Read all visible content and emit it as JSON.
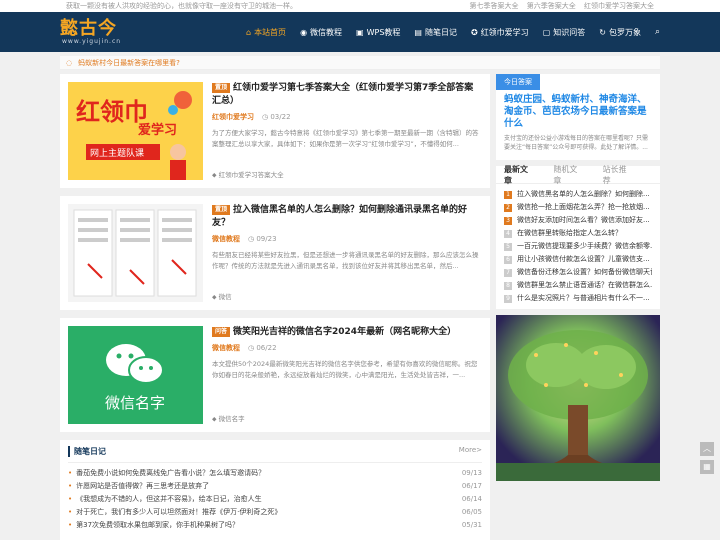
{
  "topbar": {
    "slogan": "获取一颗没有被人洪攻的经验的心，也就像守取一座没有守卫的城池一样。",
    "links": [
      "第七季答案大全",
      "第六季答案大全",
      "红领巾爱学习答案大全"
    ]
  },
  "header": {
    "logo_text": "懿古今",
    "logo_sub": "www.yigujin.cn",
    "nav": [
      {
        "label": "本站首页",
        "icon": "home-icon",
        "glyph": "⌂",
        "active": true
      },
      {
        "label": "微信教程",
        "icon": "wechat-icon",
        "glyph": "◉",
        "active": false
      },
      {
        "label": "WPS教程",
        "icon": "wps-icon",
        "glyph": "▣",
        "active": false
      },
      {
        "label": "随笔日记",
        "icon": "book-icon",
        "glyph": "▤",
        "active": false
      },
      {
        "label": "红领巾爱学习",
        "icon": "flag-icon",
        "glyph": "✪",
        "active": false
      },
      {
        "label": "知识问答",
        "icon": "qa-icon",
        "glyph": "▢",
        "active": false
      },
      {
        "label": "包罗万象",
        "icon": "refresh-icon",
        "glyph": "↻",
        "active": false
      }
    ],
    "search_glyph": "⌕"
  },
  "notice": {
    "text": "蚂蚁新村今日最新答案在哪里看?"
  },
  "posts": [
    {
      "category": "置顶",
      "category_color": "#e07a1f",
      "title": "红领巾爱学习第七季答案大全（红领巾爱学习第7季全部答案汇总）",
      "cat_name": "红领巾爱学习",
      "date": "03/22",
      "desc": "为了方便大家学习，懿古今特意将《红领巾爱学习》第七季第一期至最新一期（含特辑）的答案整理汇总以享大家，具体如下：如果你是第一次学习“红领巾爱学习”，不懂得如何...",
      "tag": "红领巾爱学习答案大全"
    },
    {
      "category": "置顶",
      "category_color": "#e07a1f",
      "title": "拉入微信黑名单的人怎么删除？如何删除通讯录黑名单的好友？",
      "cat_name": "微信教程",
      "date": "09/23",
      "desc": "有些朋友已经将某些好友拉黑，但是还想进一步将通讯录黑名单的好友删除，那么应该怎么操作呢？传统的方法就是先进入通讯录黑名单，找到该位好友并将其移出黑名单，然后...",
      "tag": "微信"
    },
    {
      "category": "问答",
      "category_color": "#e07a1f",
      "title": "微笑阳光吉祥的微信名字2024年最新（网名昵称大全）",
      "cat_name": "微信教程",
      "date": "06/22",
      "desc": "本文提供50个2024最新微笑阳光吉祥的微信名字供您参考，希望有你喜欢的微信昵称。祝您你如春日的花朵般娇艳，永远绽放着灿烂的微笑，心中满是阳光，生活处处皆吉祥，一...",
      "tag": "微信名字"
    }
  ],
  "diary": {
    "title": "随笔日记",
    "more": "More>",
    "items": [
      {
        "text": "番茄免费小说如何免费离线免广告看小说？怎么填写邀请码？",
        "date": "09/13"
      },
      {
        "text": "许愿网站是否值得做？再三思考还是放弃了",
        "date": "06/17"
      },
      {
        "text": "《我想成为不错的人，但这并不容易》，绘本日记，治愈人生",
        "date": "06/14"
      },
      {
        "text": "对于死亡，我们有多少人可以坦然面对！推荐《伊万·伊利奇之死》",
        "date": "06/05"
      },
      {
        "text": "第37次免费领取水果包邮到家，你手机种果树了吗？",
        "date": "05/31"
      }
    ]
  },
  "sidebar": {
    "today_label": "今日答案",
    "today_title": "蚂蚁庄园、蚂蚁新村、神奇海洋、淘金币、芭芭农场今日最新答案是什么",
    "today_desc": "支付宝的还份公益小游戏每日的答案在哪里看呢？只需要关注“每日答案”公众号即可获得。此处了解详情。...",
    "tabs": [
      "最新文章",
      "随机文章",
      "站长推荐"
    ],
    "ranks": [
      "拉入微信黑名单的人怎么删除？如何删除...",
      "微信抢一抢上面烟花怎么弄？抢一抢放烟...",
      "微信好友添加时间怎么看？微信添加好友...",
      "在微信群里转账给指定人怎么转？",
      "一百元微信提现要多少手续费？微信余额零...",
      "用让小孩微信付款怎么设置？儿童微信支...",
      "微信备份迁移怎么设置？如何备份微信聊天记...",
      "微信群里怎么禁止语音通话？在微信群怎么...",
      "什么是实况照片？与普通相片有什么不一..."
    ]
  },
  "float": {
    "top_glyph": "︿",
    "qr_glyph": "▦"
  }
}
